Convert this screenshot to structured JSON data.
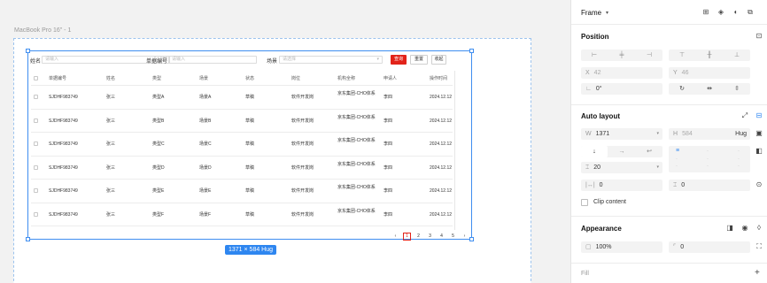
{
  "canvas": {
    "frame_label": "MacBook Pro 16\" - 1",
    "size_badge": "1371 × 584 Hug"
  },
  "filter_bar": {
    "name_label": "姓名",
    "name_placeholder": "请输入",
    "name_counter": "0 / 100",
    "doc_label": "单据编号",
    "doc_placeholder": "请输入",
    "scene_label": "场景",
    "scene_placeholder": "请选择",
    "query_label": "查询",
    "reset_label": "重置",
    "collapse_label": "收起"
  },
  "table": {
    "columns": [
      "单据编号",
      "姓名",
      "类型",
      "场景",
      "状态",
      "岗位",
      "机构全称",
      "申请人",
      "操作时间"
    ],
    "rows": [
      [
        "SJDHF983749",
        "张三",
        "类型A",
        "场景A",
        "草稿",
        "软件开发岗",
        "京东集团-CHO体系",
        "李四",
        "2024.12.12"
      ],
      [
        "SJDHF983749",
        "张三",
        "类型B",
        "场景B",
        "草稿",
        "软件开发岗",
        "京东集团-CHO体系",
        "李四",
        "2024.12.12"
      ],
      [
        "SJDHF983749",
        "张三",
        "类型C",
        "场景C",
        "草稿",
        "软件开发岗",
        "京东集团-CHO体系",
        "李四",
        "2024.12.12"
      ],
      [
        "SJDHF983749",
        "张三",
        "类型D",
        "场景D",
        "草稿",
        "软件开发岗",
        "京东集团-CHO体系",
        "李四",
        "2024.12.12"
      ],
      [
        "SJDHF983749",
        "张三",
        "类型E",
        "场景E",
        "草稿",
        "软件开发岗",
        "京东集团-CHO体系",
        "李四",
        "2024.12.12"
      ],
      [
        "SJDHF983749",
        "张三",
        "类型F",
        "场景F",
        "草稿",
        "软件开发岗",
        "京东集团-CHO体系",
        "李四",
        "2024.12.12"
      ]
    ]
  },
  "pagination": {
    "prev": "‹",
    "pages": [
      "1",
      "2",
      "3",
      "4",
      "5"
    ],
    "current": "1",
    "next": "›"
  },
  "panel": {
    "header_title": "Frame",
    "header_chevron": "▾",
    "position": {
      "title": "Position",
      "x_label": "X",
      "x_value": "42",
      "y_label": "Y",
      "y_value": "46",
      "rotation_label": "∟",
      "rotation_value": "0°"
    },
    "auto_layout": {
      "title": "Auto layout",
      "w_label": "W",
      "w_value": "1371",
      "h_label": "H",
      "h_value": "584",
      "h_mode": "Hug",
      "gap_label": "⌶",
      "gap_value": "20",
      "pad_h_label": "|↔|",
      "pad_h_value": "0",
      "pad_v_label": "⌶",
      "pad_v_value": "0",
      "clip_label": "Clip content"
    },
    "appearance": {
      "title": "Appearance",
      "opacity_value": "100%",
      "radius_value": "0"
    },
    "fill": {
      "title": "Fill",
      "add": "+"
    }
  },
  "colors": {
    "accent_blue": "#3f8ef0",
    "primary_red": "#e2231a"
  }
}
